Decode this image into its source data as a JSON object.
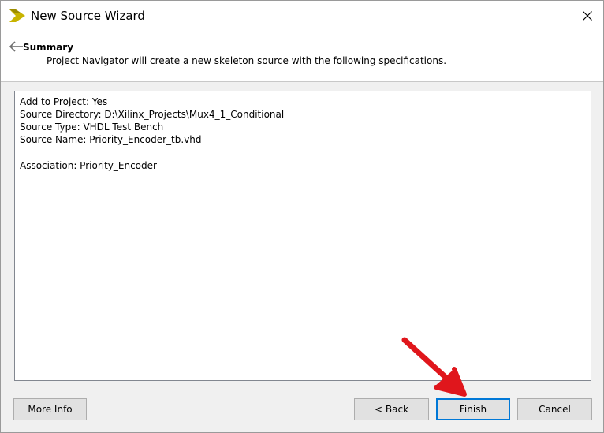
{
  "window": {
    "title": "New Source Wizard"
  },
  "header": {
    "title": "Summary",
    "description": "Project Navigator will create a new skeleton source with the following specifications."
  },
  "summary": {
    "lines": [
      "Add to Project: Yes",
      "Source Directory: D:\\Xilinx_Projects\\Mux4_1_Conditional",
      "Source Type: VHDL Test Bench",
      "Source Name: Priority_Encoder_tb.vhd",
      "",
      "Association: Priority_Encoder"
    ]
  },
  "buttons": {
    "more_info": "More Info",
    "back": "< Back",
    "finish": "Finish",
    "cancel": "Cancel"
  },
  "colors": {
    "accent": "#0078d7",
    "arrow": "#e0161c",
    "logo": "#c8b400"
  },
  "icons": {
    "app": "xilinx-logo-icon",
    "close": "close-icon",
    "back": "back-arrow-icon"
  }
}
